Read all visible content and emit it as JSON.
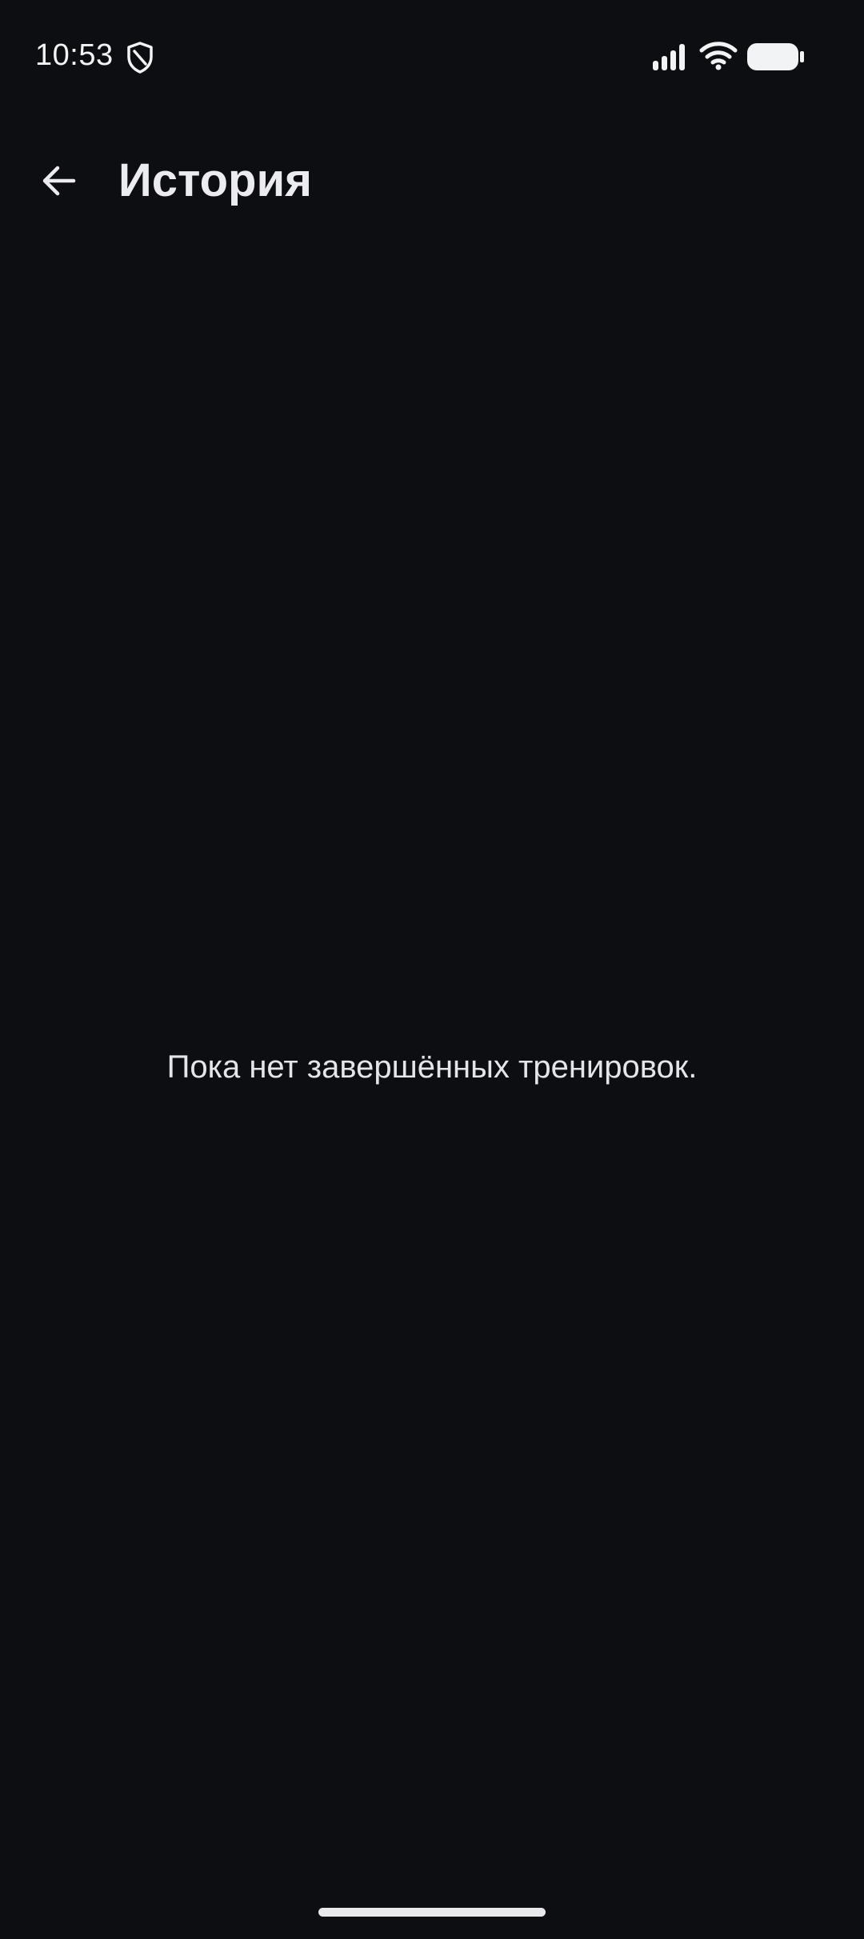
{
  "status_bar": {
    "time": "10:53",
    "icons": [
      "shield-icon",
      "signal-icon",
      "wifi-icon",
      "battery-icon"
    ]
  },
  "app_bar": {
    "back_icon": "arrow-left-icon",
    "title": "История"
  },
  "main": {
    "empty_message": "Пока нет завершённых тренировок."
  },
  "colors": {
    "background": "#0d0e12",
    "text": "#e8e9ed"
  }
}
